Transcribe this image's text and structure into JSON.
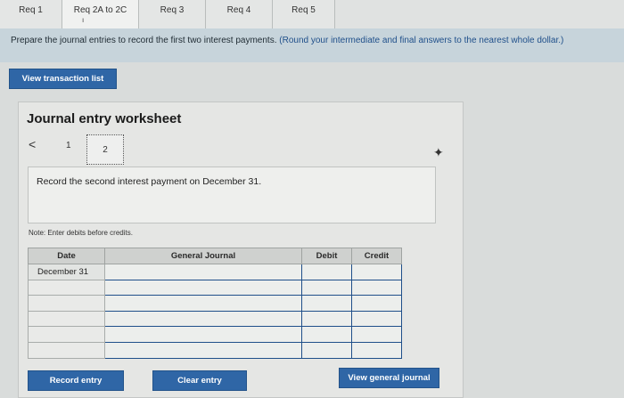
{
  "tabs": [
    {
      "label": "Req 1"
    },
    {
      "label": "Req 2A to 2C"
    },
    {
      "label": "Req 3"
    },
    {
      "label": "Req 4"
    },
    {
      "label": "Req 5"
    }
  ],
  "instruction": {
    "text": "Prepare the journal entries to record the first two interest payments.",
    "note": "(Round your intermediate and final answers to the nearest whole dollar.)"
  },
  "view_transaction_list_label": "View transaction list",
  "worksheet": {
    "title": "Journal entry worksheet",
    "prev_symbol": "<",
    "pages": [
      "1",
      "2"
    ],
    "current_page": "2",
    "description": "Record the second interest payment on December 31.",
    "note": "Note: Enter debits before credits."
  },
  "table": {
    "headers": {
      "date": "Date",
      "account": "General Journal",
      "debit": "Debit",
      "credit": "Credit"
    },
    "rows": [
      {
        "date": "December 31",
        "account": "",
        "debit": "",
        "credit": ""
      },
      {
        "date": "",
        "account": "",
        "debit": "",
        "credit": ""
      },
      {
        "date": "",
        "account": "",
        "debit": "",
        "credit": ""
      },
      {
        "date": "",
        "account": "",
        "debit": "",
        "credit": ""
      },
      {
        "date": "",
        "account": "",
        "debit": "",
        "credit": ""
      },
      {
        "date": "",
        "account": "",
        "debit": "",
        "credit": ""
      }
    ]
  },
  "buttons": {
    "record": "Record entry",
    "clear": "Clear entry",
    "view_general_journal": "View general journal"
  },
  "colors": {
    "accent": "#2f66a6",
    "instruction_bg": "#c7d4db"
  }
}
